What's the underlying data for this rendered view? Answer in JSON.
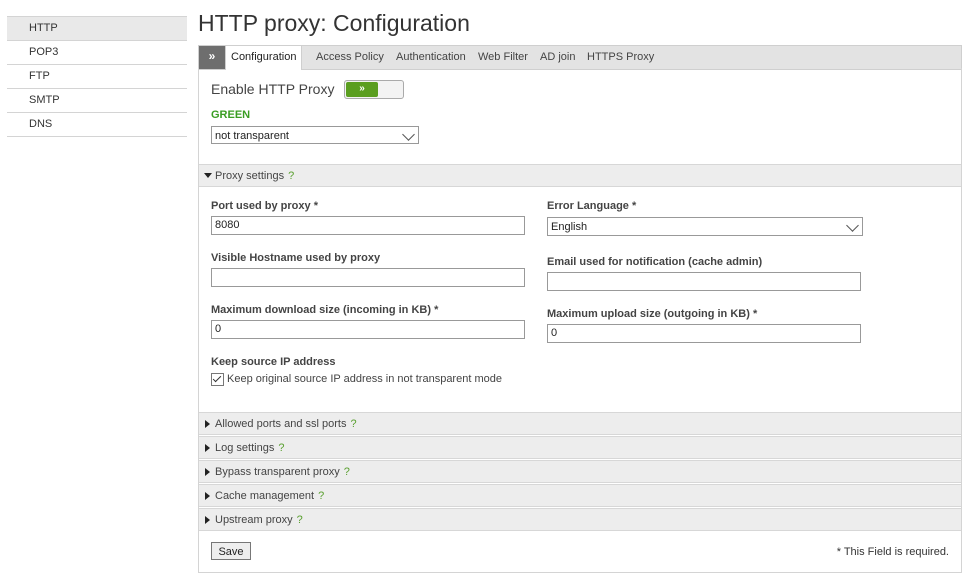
{
  "sidebar": {
    "items": [
      {
        "label": "HTTP",
        "active": true
      },
      {
        "label": "POP3"
      },
      {
        "label": "FTP"
      },
      {
        "label": "SMTP"
      },
      {
        "label": "DNS"
      }
    ]
  },
  "page": {
    "title": "HTTP proxy: Configuration"
  },
  "tabs": {
    "toggle_glyph": "»",
    "items": [
      {
        "label": "Configuration",
        "active": true
      },
      {
        "label": "Access Policy"
      },
      {
        "label": "Authentication"
      },
      {
        "label": "Web Filter"
      },
      {
        "label": "AD join"
      },
      {
        "label": "HTTPS Proxy"
      }
    ]
  },
  "enable": {
    "label": "Enable HTTP Proxy",
    "toggle_glyph": "»",
    "enabled": true
  },
  "zone": {
    "label": "GREEN",
    "mode_value": "not transparent"
  },
  "proxy_settings": {
    "title": "Proxy settings",
    "help": "?",
    "port_label": "Port used by proxy *",
    "port_value": "8080",
    "error_lang_label": "Error Language *",
    "error_lang_value": "English",
    "hostname_label": "Visible Hostname used by proxy",
    "hostname_value": "",
    "email_label": "Email used for notification (cache admin)",
    "email_value": "",
    "max_download_label": "Maximum download size (incoming in KB) *",
    "max_download_value": "0",
    "max_upload_label": "Maximum upload size (outgoing in KB) *",
    "max_upload_value": "0",
    "keep_ip_label": "Keep source IP address",
    "keep_ip_checkbox_label": "Keep original source IP address in not transparent mode",
    "keep_ip_checked": true
  },
  "sections": [
    {
      "title": "Allowed ports and ssl ports",
      "help": "?"
    },
    {
      "title": "Log settings",
      "help": "?"
    },
    {
      "title": "Bypass transparent proxy",
      "help": "?"
    },
    {
      "title": "Cache management",
      "help": "?"
    },
    {
      "title": "Upstream proxy",
      "help": "?"
    }
  ],
  "footer": {
    "save_label": "Save",
    "required_note": "* This Field is required."
  },
  "colors": {
    "green": "#3a9d23",
    "toggle_green": "#5a9e1f",
    "help": "#5aa030"
  }
}
